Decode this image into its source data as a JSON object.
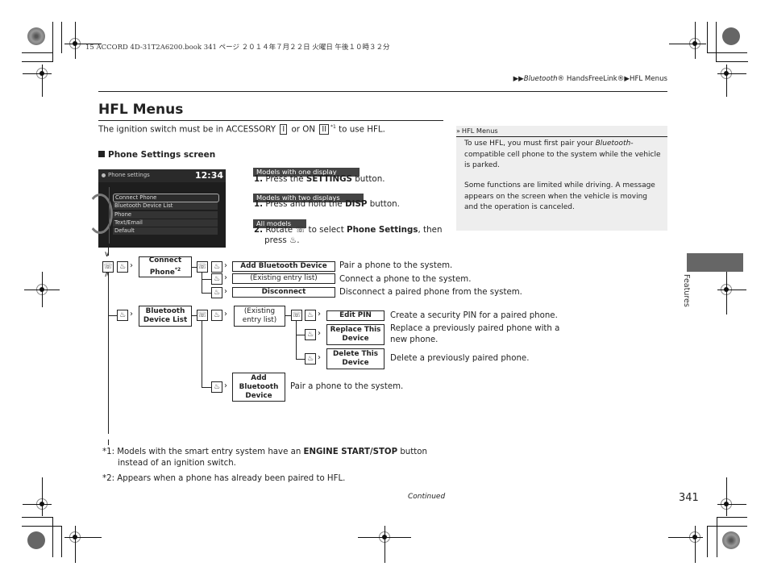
{
  "print_header": "15 ACCORD 4D-31T2A6200.book  341 ページ  ２０１４年７月２２日  火曜日  午後１０時３２分",
  "breadcrumb": {
    "arrow": "▶▶",
    "part1_italic": "Bluetooth",
    "part1_rest": "® HandsFreeLink®",
    "sep": "▶",
    "part2": "HFL Menus"
  },
  "page": {
    "title": "HFL Menus",
    "intro_before": "The ignition switch must be in ACCESSORY",
    "key1": "I",
    "intro_mid": "or ON",
    "key2": "II",
    "intro_sup": "*1",
    "intro_after": "to use HFL.",
    "section_heading": "Phone Settings screen"
  },
  "screen": {
    "title": "Phone settings",
    "clock": "12:34",
    "items": [
      "Connect Phone",
      "Bluetooth Device List",
      "Phone",
      "Text/Email",
      "Default"
    ]
  },
  "steps": [
    {
      "tag": "Models with one display",
      "num": "1.",
      "pre": "Press the",
      "bold": "SETTINGS",
      "post": "button."
    },
    {
      "tag": "Models with two displays",
      "num": "1.",
      "pre": "Press and hold the",
      "bold": "DISP",
      "post": "button."
    },
    {
      "tag": "All models",
      "num": "2.",
      "pre": "Rotate",
      "icon1": "☏",
      "mid": "to select",
      "bold": "Phone Settings",
      "post": ", then",
      "line2": "press",
      "icon2": "♨",
      "end": "."
    }
  ],
  "sidebar": {
    "icon": "»",
    "heading": "HFL Menus",
    "p1_a": "To use HFL, you must first pair your",
    "p1_italic": "Bluetooth",
    "p1_b": "-",
    "p1_line2": "compatible cell phone to the system while the vehicle",
    "p1_line3": "is parked.",
    "p2_line1": "Some functions are limited while driving. A message",
    "p2_line2": "appears on the screen when the vehicle is moving",
    "p2_line3": "and the operation is canceled."
  },
  "chapter_tab": "Features",
  "diagram": {
    "icons": {
      "rotate": "☏",
      "press": "♨",
      "arrow": "›"
    },
    "connect_phone": "Connect Phone",
    "connect_phone_sup": "*2",
    "add_bt_device": "Add Bluetooth Device",
    "existing_entry": "(Existing entry list)",
    "disconnect": "Disconnect",
    "desc_add": "Pair a phone to the system.",
    "desc_existing": "Connect a phone to the system.",
    "desc_disconnect": "Disconnect a paired phone from the system.",
    "bt_device_list_1": "Bluetooth",
    "bt_device_list_2": "Device List",
    "existing_2_1": "(Existing",
    "existing_2_2": "entry list)",
    "edit_pin": "Edit PIN",
    "replace_1": "Replace This",
    "replace_2": "Device",
    "delete_1": "Delete This",
    "delete_2": "Device",
    "add2_1": "Add",
    "add2_2": "Bluetooth",
    "add2_3": "Device",
    "desc_edit_pin": "Create a security PIN for a paired phone.",
    "desc_replace_1": "Replace a previously paired phone with a",
    "desc_replace_2": "new phone.",
    "desc_delete": "Delete a previously paired phone.",
    "desc_add2": "Pair a phone to the system."
  },
  "footnotes": [
    {
      "mark": "*1:",
      "pre": "Models with the smart entry system have an",
      "bold": "ENGINE START/STOP",
      "post": "button",
      "line2": "instead of an ignition switch."
    },
    {
      "mark": "*2:",
      "text": "Appears when a phone has already been paired to HFL."
    }
  ],
  "continued": "Continued",
  "page_number": "341"
}
